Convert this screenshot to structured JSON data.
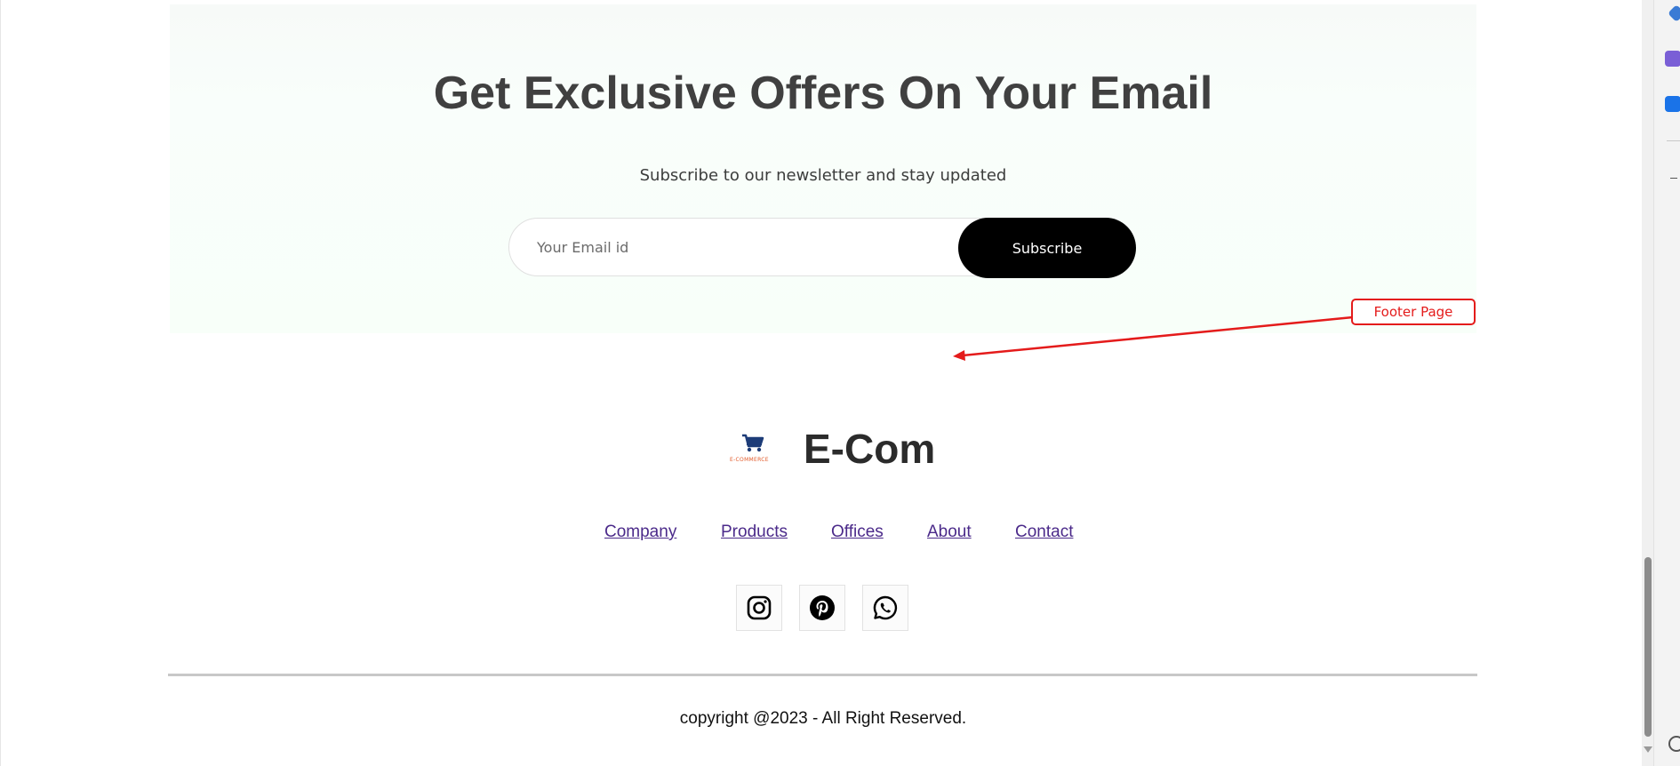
{
  "newsletter": {
    "title": "Get Exclusive Offers On Your Email",
    "subtitle": "Subscribe to our newsletter and stay updated",
    "email_placeholder": "Your Email id",
    "subscribe_label": "Subscribe"
  },
  "annotation": {
    "label": "Footer Page",
    "color": "#e41b1b"
  },
  "footer": {
    "logo_icon": "cart-icon",
    "logo_caption": "E-COMMERCE",
    "brand_name": "E-Com",
    "nav": [
      {
        "label": "Company"
      },
      {
        "label": "Products"
      },
      {
        "label": "Offices"
      },
      {
        "label": "About"
      },
      {
        "label": "Contact"
      }
    ],
    "social": [
      {
        "icon": "instagram-icon"
      },
      {
        "icon": "pinterest-icon"
      },
      {
        "icon": "whatsapp-icon"
      }
    ],
    "copyright": "copyright @2023 - All Right Reserved."
  },
  "colors": {
    "accent_button": "#000000",
    "link": "#4b2a8a",
    "newsletter_bg": "#f8fff9"
  }
}
